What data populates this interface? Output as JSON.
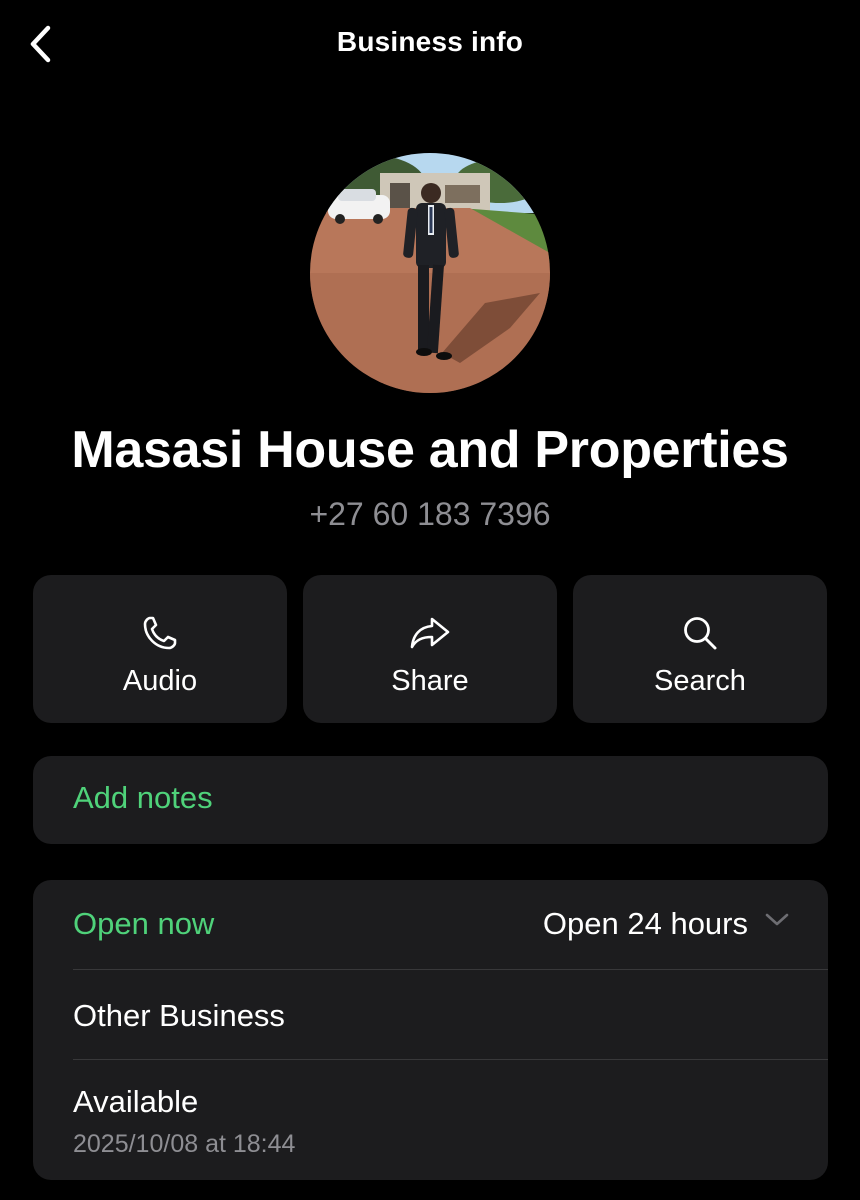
{
  "header": {
    "title": "Business info",
    "back_icon": "chevron-left-icon"
  },
  "profile": {
    "name": "Masasi House and Properties",
    "phone": "+27 60 183 7396"
  },
  "actions": [
    {
      "label": "Audio",
      "icon": "phone-icon"
    },
    {
      "label": "Share",
      "icon": "share-arrow-icon"
    },
    {
      "label": "Search",
      "icon": "search-icon"
    }
  ],
  "notes": {
    "label": "Add notes"
  },
  "business": {
    "open_status": "Open now",
    "hours": "Open 24 hours",
    "category": "Other Business",
    "availability": "Available",
    "availability_time": "2025/10/08 at 18:44"
  },
  "colors": {
    "background": "#000000",
    "card": "#1c1c1e",
    "accent_green": "#4fd27a",
    "secondary_text": "#8e8e93"
  }
}
